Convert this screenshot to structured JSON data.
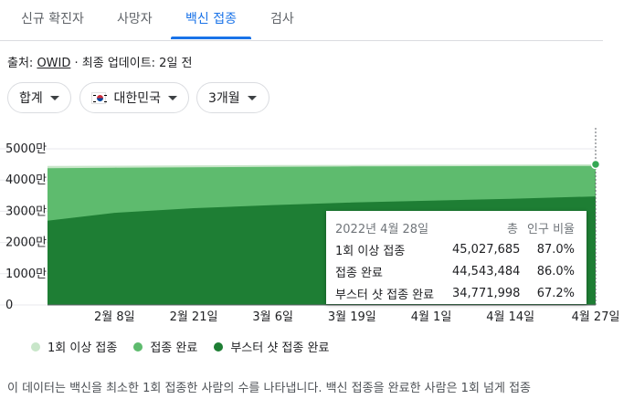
{
  "tabs": [
    "신규 확진자",
    "사망자",
    "백신 접종",
    "검사"
  ],
  "active_tab": "백신 접종",
  "source": {
    "prefix": "출처: ",
    "link": "OWID",
    "suffix": " · 최종 업데이트: 2일 전"
  },
  "filters": {
    "metric": "합계",
    "country": "대한민국",
    "period": "3개월"
  },
  "colors": {
    "first_dose": "#c8e6c9",
    "complete": "#5ebb6e",
    "booster": "#1e7e34",
    "accent": "#1a73e8"
  },
  "tooltip": {
    "date": "2022년 4월 28일",
    "col_total": "총",
    "col_pct": "인구 비율",
    "rows": [
      {
        "label": "1회 이상 접종",
        "total": "45,027,685",
        "pct": "87.0%"
      },
      {
        "label": "접종 완료",
        "total": "44,543,484",
        "pct": "86.0%"
      },
      {
        "label": "부스터 샷 접종 완료",
        "total": "34,771,998",
        "pct": "67.2%"
      }
    ]
  },
  "note": "이 데이터는 백신을 최소한 1회 접종한 사람의 수를 나타냅니다. 백신 접종을 완료한 사람은 1회 넘게 접종",
  "chart_data": {
    "type": "area",
    "y_ticks": [
      "5000만",
      "4000만",
      "3000만",
      "2000만",
      "1000만",
      "0"
    ],
    "ylim": [
      0,
      50000000
    ],
    "x_ticks": [
      "2월 8일",
      "2월 21일",
      "3월 6일",
      "3월 19일",
      "4월 1일",
      "4월 14일",
      "4월 27일"
    ],
    "x": [
      "2022-01-28",
      "2022-02-08",
      "2022-02-21",
      "2022-03-06",
      "2022-03-19",
      "2022-04-01",
      "2022-04-14",
      "2022-04-28"
    ],
    "series": [
      {
        "name": "1회 이상 접종",
        "values": [
          44500000,
          44600000,
          44700000,
          44800000,
          44850000,
          44900000,
          44950000,
          45027685
        ]
      },
      {
        "name": "접종 완료",
        "values": [
          43800000,
          43950000,
          44100000,
          44250000,
          44350000,
          44420000,
          44480000,
          44543484
        ]
      },
      {
        "name": "부스터 샷 접종 완료",
        "values": [
          27000000,
          29500000,
          31000000,
          32000000,
          32800000,
          33400000,
          34000000,
          34771998
        ]
      }
    ]
  }
}
